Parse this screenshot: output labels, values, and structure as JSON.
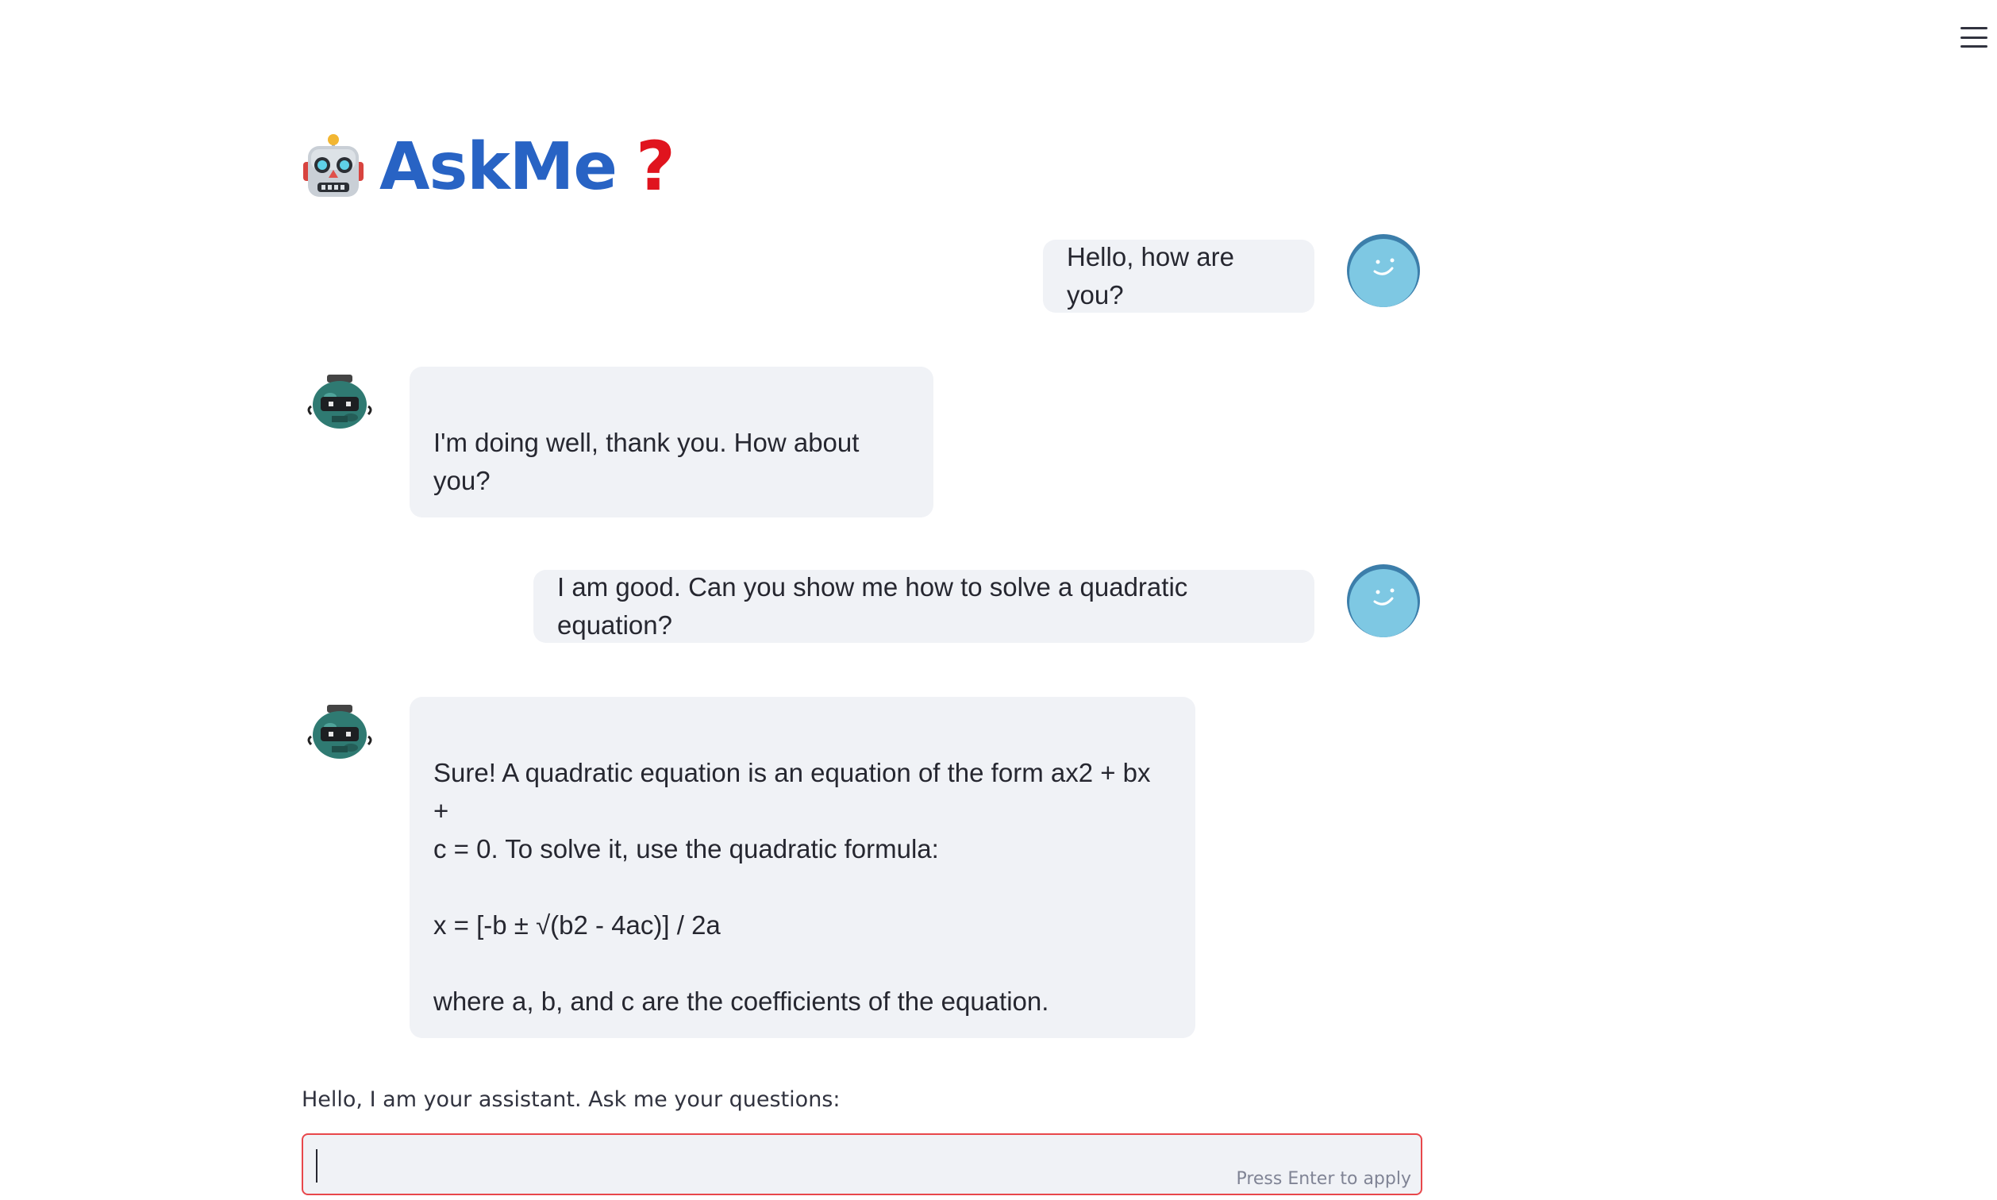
{
  "header": {
    "title": "AskMe",
    "title_question": "?",
    "menu_icon": "hamburger-menu-icon"
  },
  "messages": [
    {
      "role": "user",
      "text": "Hello, how are you?"
    },
    {
      "role": "assistant",
      "text": "I'm doing well, thank you. How about you?"
    },
    {
      "role": "user",
      "text": "I am good. Can you show me how to solve a quadratic equation?"
    },
    {
      "role": "assistant",
      "paragraphs": [
        "Sure! A quadratic equation is an equation of the form ax2 + bx +",
        "c = 0. To solve it, use the quadratic formula:",
        "x = [-b ± √(b2 - 4ac)] / 2a",
        "where a, b, and c are the coefficients of the equation."
      ]
    }
  ],
  "input": {
    "label": "Hello, I am your assistant. Ask me your questions:",
    "value": "",
    "hint": "Press Enter to apply"
  },
  "colors": {
    "title": "#2863c4",
    "question_mark": "#e0141e",
    "bubble_bg": "#f0f2f6",
    "user_avatar": "#7ec8e3",
    "bot_avatar": "#2f7a72",
    "input_border": "#e8474b"
  }
}
